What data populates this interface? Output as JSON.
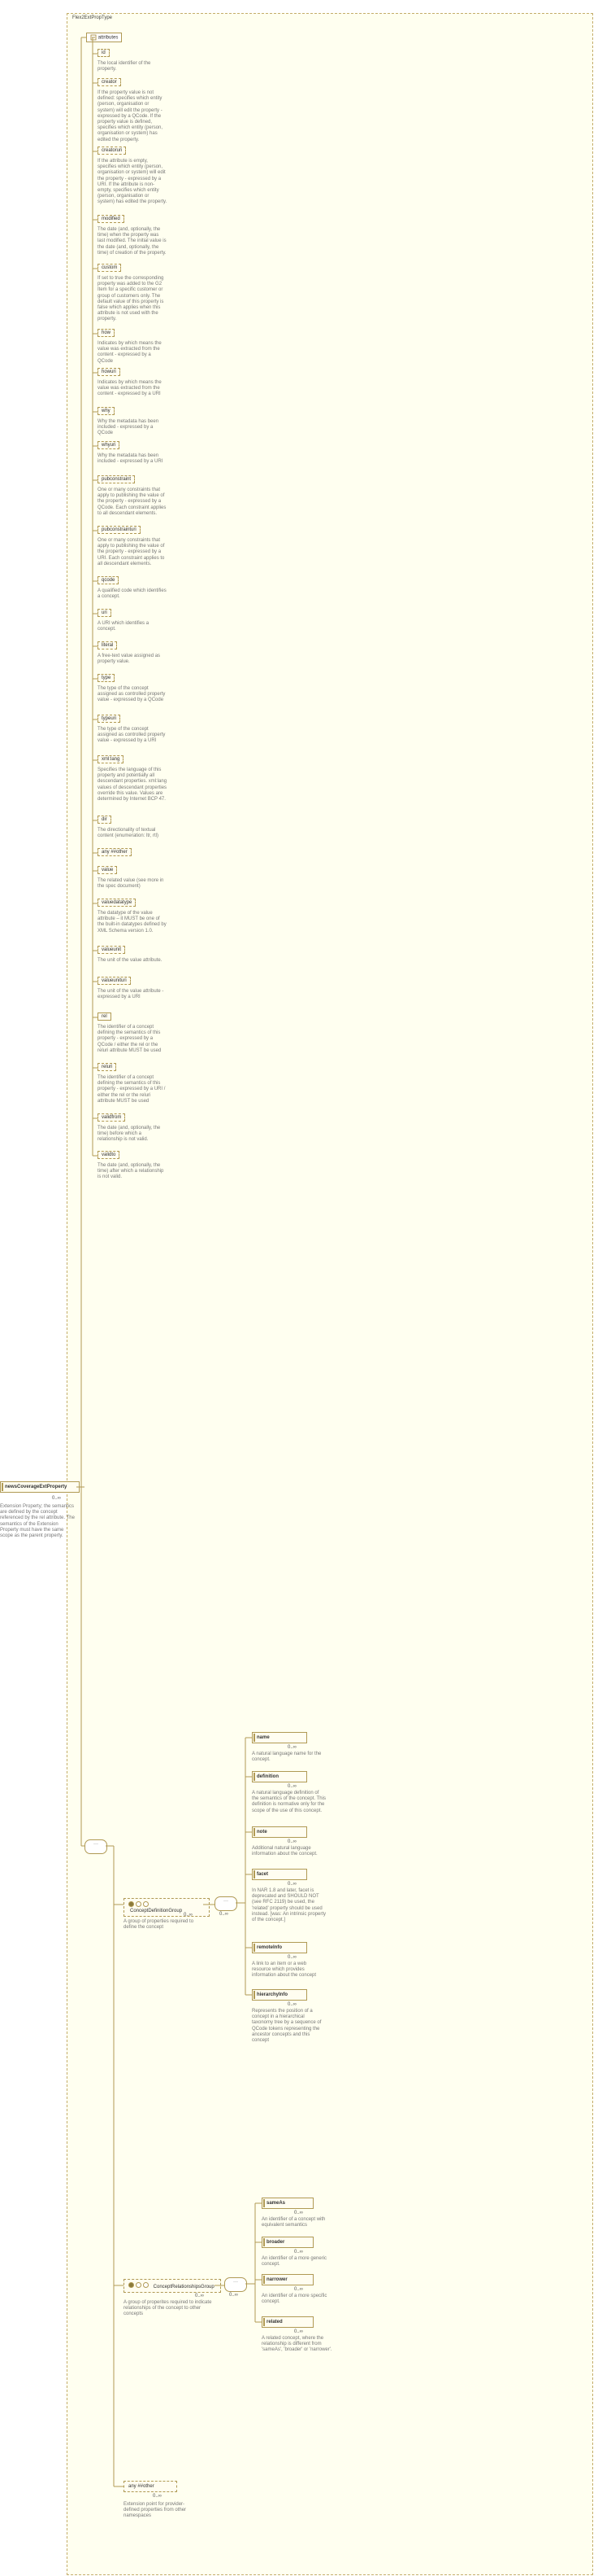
{
  "type_name": "Flex2ExtPropType",
  "main_element": {
    "name": "newsCoverageExtProperty",
    "card": "0..∞"
  },
  "main_doc": "Extension Property; the semantics are defined by the concept referenced by the rel attribute. The semantics of the Extension Property must have the same scope as the parent property.",
  "attributes_label": "attributes",
  "attributes": [
    {
      "name": "id",
      "doc": "The local identifier of the property."
    },
    {
      "name": "creator",
      "doc": "If the property value is not defined: specifies which entity (person, organisation or system) will edit the property - expressed by a QCode. If the property value is defined, specifies which entity (person, organisation or system) has edited the property."
    },
    {
      "name": "creatoruri",
      "doc": "If the attribute is empty, specifies which entity (person, organisation or system) will edit the property - expressed by a URI. If the attribute is non-empty, specifies which entity (person, organisation or system) has edited the property."
    },
    {
      "name": "modified",
      "doc": "The date (and, optionally, the time) when the property was last modified. The initial value is the date (and, optionally, the time) of creation of the property."
    },
    {
      "name": "custom",
      "doc": "If set to true the corresponding property was added to the G2 Item for a specific customer or group of customers only. The default value of this property is false which applies when this attribute is not used with the property."
    },
    {
      "name": "how",
      "doc": "Indicates by which means the value was extracted from the content - expressed by a QCode"
    },
    {
      "name": "howuri",
      "doc": "Indicates by which means the value was extracted from the content - expressed by a URI"
    },
    {
      "name": "why",
      "doc": "Why the metadata has been included - expressed by a QCode"
    },
    {
      "name": "whyuri",
      "doc": "Why the metadata has been included - expressed by a URI"
    },
    {
      "name": "pubconstraint",
      "doc": "One or many constraints that apply to publishing the value of the property - expressed by a QCode. Each constraint applies to all descendant elements."
    },
    {
      "name": "pubconstrainturi",
      "doc": "One or many constraints that apply to publishing the value of the property - expressed by a URI. Each constraint applies to all descendant elements."
    },
    {
      "name": "qcode",
      "doc": "A qualified code which identifies a concept."
    },
    {
      "name": "uri",
      "doc": "A URI which identifies a concept."
    },
    {
      "name": "literal",
      "doc": "A free-text value assigned as property value."
    },
    {
      "name": "type",
      "doc": "The type of the concept assigned as controlled property value - expressed by a QCode"
    },
    {
      "name": "typeuri",
      "doc": "The type of the concept assigned as controlled property value - expressed by a URI"
    },
    {
      "name": "xml:lang",
      "doc": "Specifies the language of this property and potentially all descendant properties. xml:lang values of descendant properties override this value. Values are determined by Internet BCP 47."
    },
    {
      "name": "dir",
      "doc": "The directionality of textual content (enumeration: ltr, rtl)"
    },
    {
      "name": "any ##other"
    },
    {
      "name": "value",
      "doc": "The related value (see more in the spec document)"
    },
    {
      "name": "valuedatatype",
      "doc": "The datatype of the value attribute – it MUST be one of the built-in datatypes defined by XML Schema version 1.0."
    },
    {
      "name": "valueunit",
      "doc": "The unit of the value attribute."
    },
    {
      "name": "valueunituri",
      "doc": "The unit of the value attribute - expressed by a URI"
    },
    {
      "name": "rel",
      "solid": true,
      "doc": "The identifier of a concept defining the semantics of this property - expressed by a QCode / either the rel or the reluri attribute MUST be used"
    },
    {
      "name": "reluri",
      "doc": "The identifier of a concept defining the semantics of this property - expressed by a URI / either the rel or the reluri attribute MUST be used"
    },
    {
      "name": "validfrom",
      "doc": "The date (and, optionally, the time) before which a relationship is not valid."
    },
    {
      "name": "validto",
      "doc": "The date (and, optionally, the time) after which a relationship is not valid."
    }
  ],
  "cdg": {
    "name": "ConceptDefinitionGroup",
    "card": "0..∞",
    "doc": "A group of properties required to define the concept"
  },
  "cdg_children": [
    {
      "name": "name",
      "doc": "A natural language name for the concept."
    },
    {
      "name": "definition",
      "doc": "A natural language definition of the semantics of the concept. This definition is normative only for the scope of the use of this concept."
    },
    {
      "name": "note",
      "doc": "Additional natural language information about the concept."
    },
    {
      "name": "facet",
      "doc": "In NAR 1.8 and later, facet is deprecated and SHOULD NOT (see RFC 2119) be used, the 'related' property should be used instead. [was: An intrinsic property of the concept.]"
    },
    {
      "name": "remoteInfo",
      "doc": "A link to an item or a web resource which provides information about the concept"
    },
    {
      "name": "hierarchyInfo",
      "doc": "Represents the position of a concept in a hierarchical taxonomy tree by a sequence of QCode tokens representing the ancestor concepts and this concept"
    }
  ],
  "crg": {
    "name": "ConceptRelationshipsGroup",
    "card": "0..∞",
    "doc": "A group of properites required to indicate relationships of the concept to other concepts"
  },
  "crg_children": [
    {
      "name": "sameAs",
      "doc": "An identifier of a concept with equivalent semantics"
    },
    {
      "name": "broader",
      "doc": "An identifier of a more generic concept."
    },
    {
      "name": "narrower",
      "doc": "An identifier of a more specific concept."
    },
    {
      "name": "related",
      "doc": "A related concept, where the relationship is different from 'sameAs', 'broader' or 'narrower'."
    }
  ],
  "any_other": {
    "name": "any ##other",
    "card": "0..∞",
    "doc": "Extension point for provider-defined properties from other namespaces"
  }
}
